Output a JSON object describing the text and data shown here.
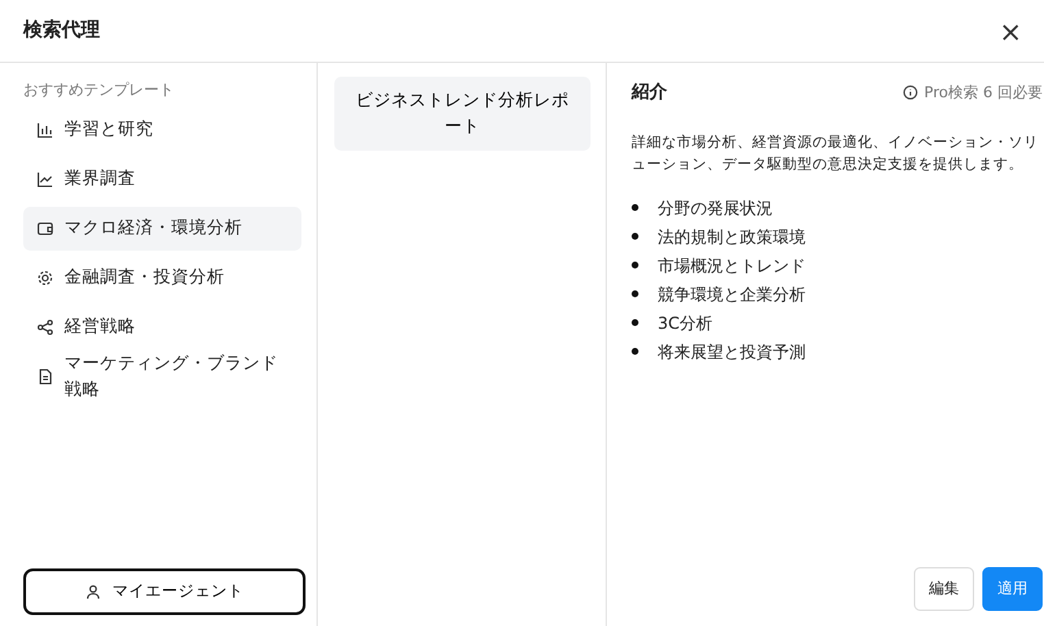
{
  "window": {
    "title": "検索代理",
    "close": "×"
  },
  "sidebar": {
    "heading": "おすすめテンプレート",
    "items": [
      {
        "label": "学習と研究",
        "kind": "bars",
        "selected": false
      },
      {
        "label": "業界調査",
        "kind": "line",
        "selected": false
      },
      {
        "label": "マクロ経済・環境分析",
        "kind": "wallet",
        "selected": true
      },
      {
        "label": "金融調査・投資分析",
        "kind": "gear",
        "selected": false
      },
      {
        "label": "経営戦略",
        "kind": "share",
        "selected": false
      },
      {
        "label": "マーケティング・ブランド戦略",
        "kind": "doc",
        "selected": false
      }
    ],
    "agent_button": "マイエージェント"
  },
  "templates": [
    {
      "label": "ビジネストレンド分析レポート",
      "selected": true
    }
  ],
  "detail": {
    "title": "紹介",
    "requirement": "Pro検索 6 回必要",
    "description": "詳細な市場分析、経営資源の最適化、イノベーション・ソリューション、データ駆動型の意思決定支援を提供します。",
    "points": [
      "分野の発展状況",
      "法的規制と政策環境",
      "市場概況とトレンド",
      "競争環境と企業分析",
      "3C分析",
      "将来展望と投資予測"
    ]
  },
  "buttons": [
    {
      "label": "編集",
      "kind": "secondary"
    },
    {
      "label": "適用",
      "kind": "primary"
    }
  ]
}
